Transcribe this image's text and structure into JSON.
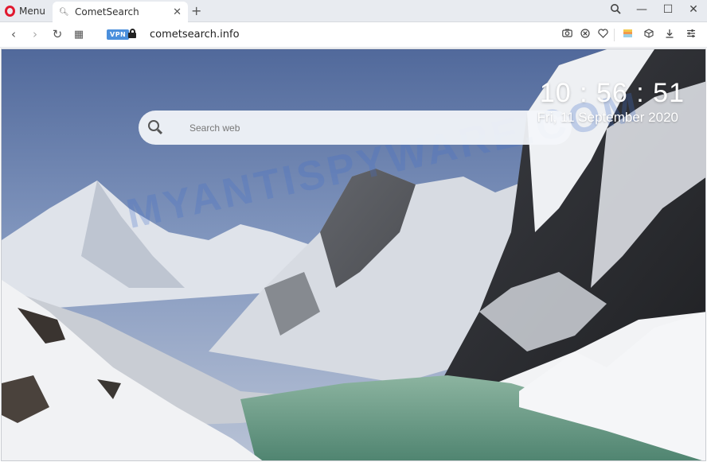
{
  "browser": {
    "menu_label": "Menu",
    "tab": {
      "title": "CometSearch",
      "icon": "search-icon",
      "close": "✕"
    },
    "new_tab": "+",
    "window_controls": {
      "search": "search-icon",
      "minimize": "—",
      "maximize": "☐",
      "close": "✕"
    },
    "nav": {
      "back": "‹",
      "forward": "›",
      "reload": "↻",
      "speed_dial": "▦"
    },
    "vpn_label": "VPN",
    "url": "cometsearch.info",
    "toolbar_icons": [
      "camera-icon",
      "block-icon",
      "heart-icon",
      "wallet-icon",
      "cube-icon",
      "download-icon",
      "settings-icon"
    ]
  },
  "page": {
    "search": {
      "placeholder": "Search web",
      "value": ""
    },
    "clock": "10 : 56 : 51",
    "date": "Fri, 11 September 2020",
    "watermark": "MYANTISPYWARE.COM"
  },
  "colors": {
    "opera_red": "#e1192f",
    "vpn_blue": "#4b8fdc",
    "sky": "#5a76a8",
    "lake": "#6f9e8a"
  }
}
